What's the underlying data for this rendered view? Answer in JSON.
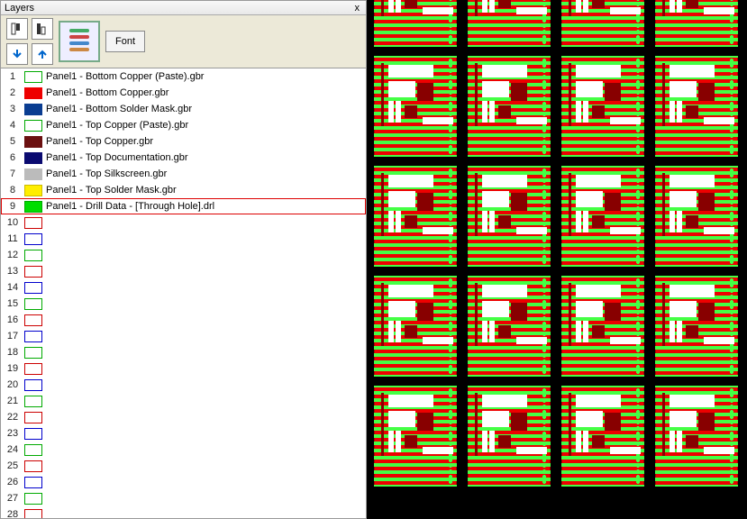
{
  "panel": {
    "title": "Layers",
    "close": "x",
    "font_button": "Font"
  },
  "layers": [
    {
      "num": 1,
      "fill": "#ffffff",
      "border": "#00aa00",
      "label": "Panel1 - Bottom Copper (Paste).gbr",
      "selected": false
    },
    {
      "num": 2,
      "fill": "#ee0000",
      "border": "#ee0000",
      "label": "Panel1 - Bottom Copper.gbr",
      "selected": false
    },
    {
      "num": 3,
      "fill": "#0a3d91",
      "border": "#0a3d91",
      "label": "Panel1 - Bottom Solder Mask.gbr",
      "selected": false
    },
    {
      "num": 4,
      "fill": "#ffffff",
      "border": "#00aa00",
      "label": "Panel1 - Top Copper (Paste).gbr",
      "selected": false
    },
    {
      "num": 5,
      "fill": "#6b1010",
      "border": "#6b1010",
      "label": "Panel1 - Top Copper.gbr",
      "selected": false
    },
    {
      "num": 6,
      "fill": "#0a0a70",
      "border": "#0a0a70",
      "label": "Panel1 - Top Documentation.gbr",
      "selected": false
    },
    {
      "num": 7,
      "fill": "#bbbbbb",
      "border": "#bbbbbb",
      "label": "Panel1 - Top Silkscreen.gbr",
      "selected": false
    },
    {
      "num": 8,
      "fill": "#ffee00",
      "border": "#ccbb00",
      "label": "Panel1 - Top Solder Mask.gbr",
      "selected": false
    },
    {
      "num": 9,
      "fill": "#00dd00",
      "border": "#00aa00",
      "label": "Panel1 - Drill Data - [Through Hole].drl",
      "selected": true
    },
    {
      "num": 10,
      "fill": "#ffffff",
      "border": "#cc0000",
      "label": "",
      "selected": false
    },
    {
      "num": 11,
      "fill": "#ffffff",
      "border": "#0000cc",
      "label": "",
      "selected": false
    },
    {
      "num": 12,
      "fill": "#ffffff",
      "border": "#00aa00",
      "label": "",
      "selected": false
    },
    {
      "num": 13,
      "fill": "#ffffff",
      "border": "#cc0000",
      "label": "",
      "selected": false
    },
    {
      "num": 14,
      "fill": "#ffffff",
      "border": "#0000cc",
      "label": "",
      "selected": false
    },
    {
      "num": 15,
      "fill": "#ffffff",
      "border": "#00aa00",
      "label": "",
      "selected": false
    },
    {
      "num": 16,
      "fill": "#ffffff",
      "border": "#cc0000",
      "label": "",
      "selected": false
    },
    {
      "num": 17,
      "fill": "#ffffff",
      "border": "#0000cc",
      "label": "",
      "selected": false
    },
    {
      "num": 18,
      "fill": "#ffffff",
      "border": "#00aa00",
      "label": "",
      "selected": false
    },
    {
      "num": 19,
      "fill": "#ffffff",
      "border": "#cc0000",
      "label": "",
      "selected": false
    },
    {
      "num": 20,
      "fill": "#ffffff",
      "border": "#0000cc",
      "label": "",
      "selected": false
    },
    {
      "num": 21,
      "fill": "#ffffff",
      "border": "#00aa00",
      "label": "",
      "selected": false
    },
    {
      "num": 22,
      "fill": "#ffffff",
      "border": "#cc0000",
      "label": "",
      "selected": false
    },
    {
      "num": 23,
      "fill": "#ffffff",
      "border": "#0000cc",
      "label": "",
      "selected": false
    },
    {
      "num": 24,
      "fill": "#ffffff",
      "border": "#00aa00",
      "label": "",
      "selected": false
    },
    {
      "num": 25,
      "fill": "#ffffff",
      "border": "#cc0000",
      "label": "",
      "selected": false
    },
    {
      "num": 26,
      "fill": "#ffffff",
      "border": "#0000cc",
      "label": "",
      "selected": false
    },
    {
      "num": 27,
      "fill": "#ffffff",
      "border": "#00aa00",
      "label": "",
      "selected": false
    },
    {
      "num": 28,
      "fill": "#ffffff",
      "border": "#cc0000",
      "label": "",
      "selected": false
    }
  ],
  "viewer": {
    "board_count": 20
  }
}
